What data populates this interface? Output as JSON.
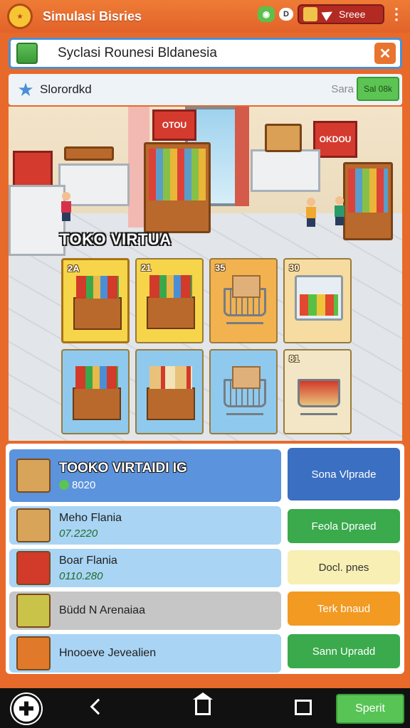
{
  "app": {
    "title": "Simulasi Bisries"
  },
  "topbar": {
    "toggle_text": "D",
    "pill_text": "Sreee"
  },
  "search": {
    "text": "Syclasi Rounesi Bldanesia"
  },
  "subbar": {
    "title": "Slorordkd",
    "right_label": "Sara",
    "right_button": "Sal 08k"
  },
  "scene": {
    "title": "TOKO VIRTUA",
    "signs": [
      "OTOU",
      "OKDOU"
    ],
    "tiles": [
      {
        "num": "2A",
        "kind": "shelf-red",
        "bg": "#f6d54a"
      },
      {
        "num": "21",
        "kind": "shelf-red",
        "bg": "#f6d54a"
      },
      {
        "num": "35",
        "kind": "cart-box",
        "bg": "#f2b24f"
      },
      {
        "num": "30",
        "kind": "fridge",
        "bg": "#f6dca0"
      },
      {
        "num": "",
        "kind": "shelf-red",
        "bg": "#8fcaee"
      },
      {
        "num": "",
        "kind": "shelf-box",
        "bg": "#8fcaee"
      },
      {
        "num": "",
        "kind": "box-cart",
        "bg": "#8fcaee"
      },
      {
        "num": "81",
        "kind": "cart-red",
        "bg": "#f2e6c6"
      }
    ]
  },
  "inventory": [
    {
      "name": "TOOKO VIRTAIDI IG",
      "value": "8020",
      "thumb_color": "#d8a45a"
    },
    {
      "name": "Meho Flania",
      "value": "07.2220",
      "thumb_color": "#d8a45a"
    },
    {
      "name": "Boar Flania",
      "value": "0110.280",
      "thumb_color": "#d23a2a"
    },
    {
      "name": "Büdd N  Arenaiaa",
      "value": "",
      "thumb_color": "#c9c34a"
    },
    {
      "name": "Hnooeve Jevealien",
      "value": "",
      "thumb_color": "#e07a2a"
    }
  ],
  "actions": [
    {
      "label": "Sona Vlprade",
      "bg": "#3b6fc2",
      "fg": "#ffffff"
    },
    {
      "label": "Feola Dpraed",
      "bg": "#3aaa4c",
      "fg": "#ffffff"
    },
    {
      "label": "Docl. pnes",
      "bg": "#f7efb4",
      "fg": "#333333"
    },
    {
      "label": "Terk bnaud",
      "bg": "#f29a22",
      "fg": "#ffffff"
    },
    {
      "label": "Sann Upradd",
      "bg": "#3aaa4c",
      "fg": "#ffffff"
    }
  ],
  "navbar": {
    "start_label": "Sperit"
  }
}
